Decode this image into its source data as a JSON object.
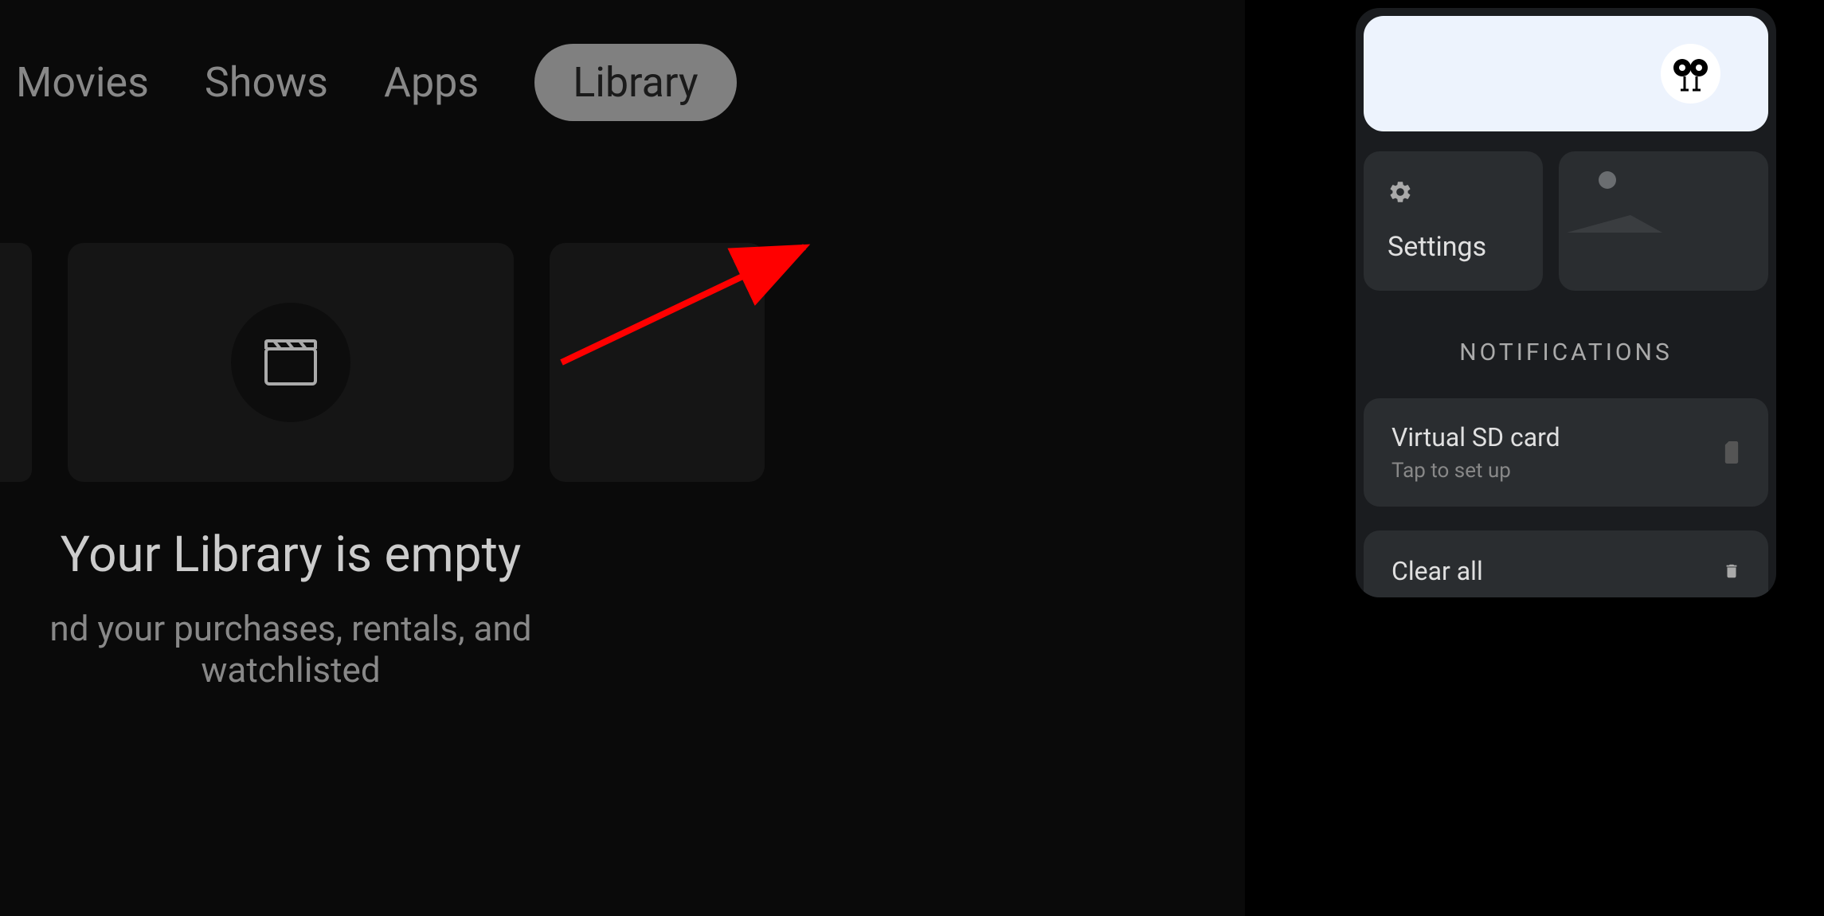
{
  "tabs": {
    "movies": "Movies",
    "shows": "Shows",
    "apps": "Apps",
    "library": "Library"
  },
  "library": {
    "empty_title": "Your Library is empty",
    "empty_subtitle": "nd your purchases, rentals, and watchlisted"
  },
  "panel": {
    "settings_label": "Settings",
    "notifications_header": "NOTIFICATIONS",
    "notification": {
      "title": "Virtual SD card",
      "subtitle": "Tap to set up"
    },
    "clear_all": "Clear all"
  }
}
